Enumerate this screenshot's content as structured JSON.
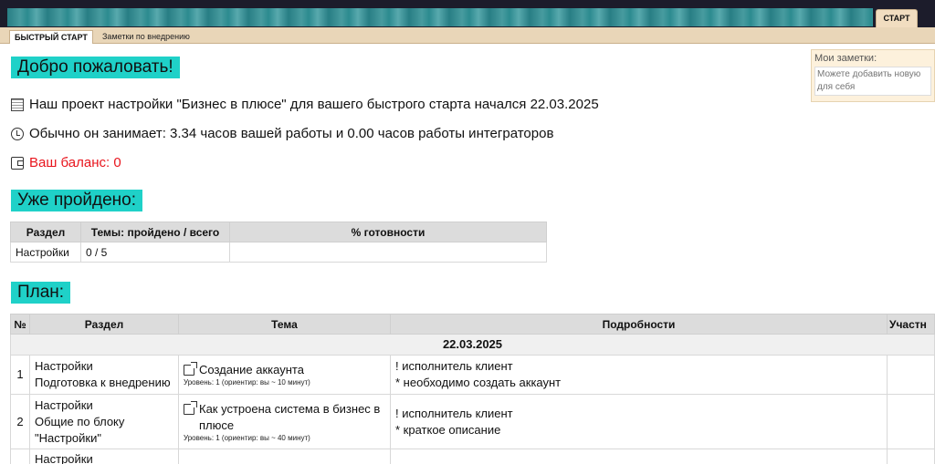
{
  "header": {
    "start_tab": "СТАРТ"
  },
  "tabs": [
    {
      "label": "БЫСТРЫЙ СТАРТ",
      "active": true
    },
    {
      "label": "Заметки по внедрению",
      "active": false
    }
  ],
  "welcome": "Добро пожаловать!",
  "info": {
    "project_line": "Наш проект настройки \"Бизнес в плюсе\" для вашего быстрого старта начался 22.03.2025",
    "time_line": "Обычно он занимает: 3.34 часов вашей работы и 0.00 часов работы интеграторов",
    "balance_line": "Ваш баланс: 0"
  },
  "notes": {
    "label": "Мои заметки:",
    "placeholder": "Можете добавить новую для себя"
  },
  "done": {
    "heading": "Уже пройдено:",
    "columns": [
      "Раздел",
      "Темы: пройдено / всего",
      "% готовности"
    ],
    "rows": [
      {
        "section": "Настройки",
        "topics": "0 / 5",
        "percent": ""
      }
    ]
  },
  "plan": {
    "heading": "План:",
    "columns": [
      "№",
      "Раздел",
      "Тема",
      "Подробности",
      "Участн"
    ],
    "date": "22.03.2025",
    "rows": [
      {
        "num": "1",
        "section_1": "Настройки",
        "section_2": "Подготовка к внедрению",
        "topic": "Создание аккаунта",
        "level": "Уровень: 1 (ориентир: вы ~ 10 минут)",
        "detail_1": "! исполнитель клиент",
        "detail_2": "* необходимо создать аккаунт"
      },
      {
        "num": "2",
        "section_1": "Настройки",
        "section_2": "Общие по блоку",
        "section_3": "\"Настройки\"",
        "topic": "Как устроена система в бизнес в плюсе",
        "level": "Уровень: 1 (ориентир: вы ~ 40 минут)",
        "detail_1": "! исполнитель клиент",
        "detail_2": "* краткое описание"
      },
      {
        "num": "",
        "section_1": "Настройки"
      }
    ]
  }
}
